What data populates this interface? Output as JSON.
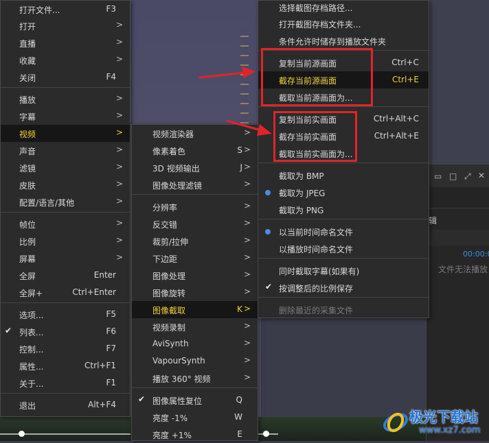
{
  "menu1": {
    "items": [
      {
        "label": "打开文件...",
        "shortcut": "F3"
      },
      {
        "label": "打开",
        "arrow": true
      },
      {
        "label": "直播",
        "arrow": true
      },
      {
        "label": "收藏",
        "arrow": true
      },
      {
        "label": "关闭",
        "shortcut": "F4"
      },
      {
        "label": "播放",
        "arrow": true
      },
      {
        "label": "字幕",
        "arrow": true
      },
      {
        "label": "视频",
        "arrow": true
      },
      {
        "label": "声音",
        "arrow": true
      },
      {
        "label": "滤镜",
        "arrow": true
      },
      {
        "label": "皮肤",
        "arrow": true
      },
      {
        "label": "配置/语言/其他",
        "arrow": true
      },
      {
        "label": "帧位",
        "arrow": true
      },
      {
        "label": "比例",
        "arrow": true
      },
      {
        "label": "屏幕",
        "arrow": true
      },
      {
        "label": "全屏",
        "shortcut": "Enter"
      },
      {
        "label": "全屏+",
        "shortcut": "Ctrl+Enter"
      },
      {
        "label": "选项...",
        "shortcut": "F5"
      },
      {
        "label": "列表...",
        "shortcut": "F6"
      },
      {
        "label": "控制...",
        "shortcut": "F7"
      },
      {
        "label": "属性...",
        "shortcut": "Ctrl+F1"
      },
      {
        "label": "关于...",
        "shortcut": "F1"
      },
      {
        "label": "退出",
        "shortcut": "Alt+F4"
      }
    ]
  },
  "menu2": {
    "items": [
      {
        "label": "视频渲染器",
        "arrow": true
      },
      {
        "label": "像素着色",
        "shortcut": "S"
      },
      {
        "label": "3D 视频输出",
        "shortcut": "J"
      },
      {
        "label": "图像处理滤镜",
        "arrow": true
      },
      {
        "label": "分辨率",
        "arrow": true
      },
      {
        "label": "反交错",
        "arrow": true
      },
      {
        "label": "裁剪/拉伸",
        "arrow": true
      },
      {
        "label": "下边距",
        "arrow": true
      },
      {
        "label": "图像处理",
        "arrow": true
      },
      {
        "label": "图像旋转",
        "arrow": true
      },
      {
        "label": "图像截取",
        "shortcut": "K"
      },
      {
        "label": "视频录制",
        "arrow": true
      },
      {
        "label": "AviSynth",
        "arrow": true
      },
      {
        "label": "VapourSynth",
        "arrow": true
      },
      {
        "label": "播放 360° 视频",
        "arrow": true
      },
      {
        "label": "图像属性复位",
        "shortcut": "Q"
      },
      {
        "label": "亮度 -1%",
        "shortcut": "W"
      },
      {
        "label": "亮度 +1%",
        "shortcut": "E"
      }
    ]
  },
  "menu3": {
    "items": [
      {
        "label": "选择截图存档路径..."
      },
      {
        "label": "打开截图存档文件夹..."
      },
      {
        "label": "条件允许时储存到播放文件夹"
      },
      {
        "label": "复制当前源画面",
        "shortcut": "Ctrl+C"
      },
      {
        "label": "截存当前源画面",
        "shortcut": "Ctrl+E"
      },
      {
        "label": "截取当前源画面为..."
      },
      {
        "label": "复制当前实画面",
        "shortcut": "Ctrl+Alt+C"
      },
      {
        "label": "截存当前实画面",
        "shortcut": "Ctrl+Alt+E"
      },
      {
        "label": "截取当前实画面为..."
      },
      {
        "label": "截取为 BMP"
      },
      {
        "label": "截取为 JPEG"
      },
      {
        "label": "截取为 PNG"
      },
      {
        "label": "以当前时间命名文件"
      },
      {
        "label": "以播放时间命名文件"
      },
      {
        "label": "同时截取字幕(如果有)"
      },
      {
        "label": "按调整后的比例保存"
      },
      {
        "label": "删除最近的采集文件"
      }
    ]
  },
  "background": {
    "panel_text_1": "辑",
    "timecode": "00:00:0",
    "cannot_play": "文件无法播放"
  },
  "watermark": {
    "site_name": "极光下载站",
    "url": "www.xz7.com"
  },
  "colors": {
    "highlight_text": "#f0d13a",
    "annotation_red": "#e0242a",
    "radio_blue": "#4a8de0"
  }
}
